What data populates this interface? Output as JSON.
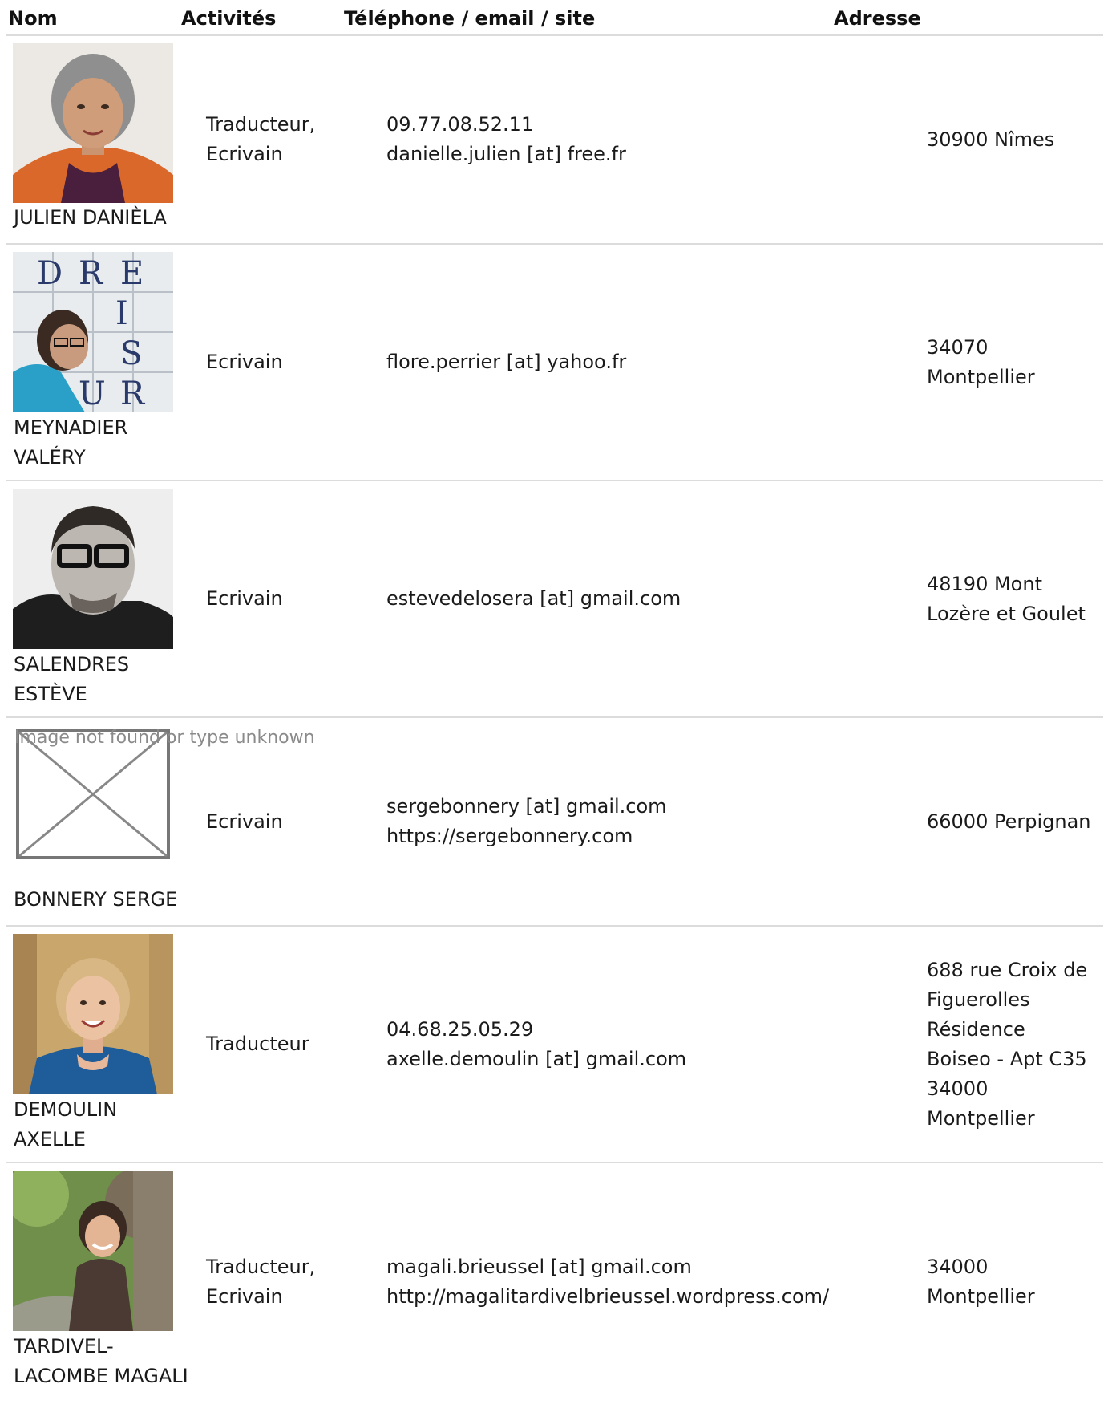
{
  "headers": {
    "name": "Nom",
    "activities": "Activités",
    "contact": "Téléphone / email / site",
    "address": "Adresse"
  },
  "rows": [
    {
      "name": "JULIEN DANIÈLA",
      "activities": [
        "Traducteur,",
        "Ecrivain"
      ],
      "contact": [
        "09.77.08.52.11",
        "danielle.julien [at] free.fr"
      ],
      "address": [
        "30900 Nîmes"
      ]
    },
    {
      "name": "MEYNADIER VALÉRY",
      "activities": [
        "Ecrivain"
      ],
      "contact": [
        "flore.perrier [at] yahoo.fr"
      ],
      "address": [
        "34070",
        "Montpellier"
      ]
    },
    {
      "name": "SALENDRES ESTÈVE",
      "activities": [
        "Ecrivain"
      ],
      "contact": [
        "estevedelosera [at] gmail.com"
      ],
      "address": [
        "48190 Mont",
        "Lozère et Goulet"
      ]
    },
    {
      "name": "BONNERY SERGE",
      "image_missing_text": "Image not found or type unknown",
      "activities": [
        "Ecrivain"
      ],
      "contact": [
        "sergebonnery [at] gmail.com",
        "https://sergebonnery.com"
      ],
      "address": [
        "66000 Perpignan"
      ]
    },
    {
      "name": "DEMOULIN AXELLE",
      "activities": [
        "Traducteur"
      ],
      "contact": [
        "04.68.25.05.29",
        "axelle.demoulin [at] gmail.com"
      ],
      "address": [
        "688 rue Croix de",
        "Figuerolles",
        "Résidence",
        "Boiseo - Apt C35",
        "34000",
        "Montpellier"
      ]
    },
    {
      "name": "TARDIVEL-LACOMBE MAGALI",
      "activities": [
        "Traducteur,",
        "Ecrivain"
      ],
      "contact": [
        "magali.brieussel [at] gmail.com",
        "http://magalitardivelbrieussel.wordpress.com/"
      ],
      "address": [
        "34000",
        "Montpellier"
      ]
    }
  ]
}
